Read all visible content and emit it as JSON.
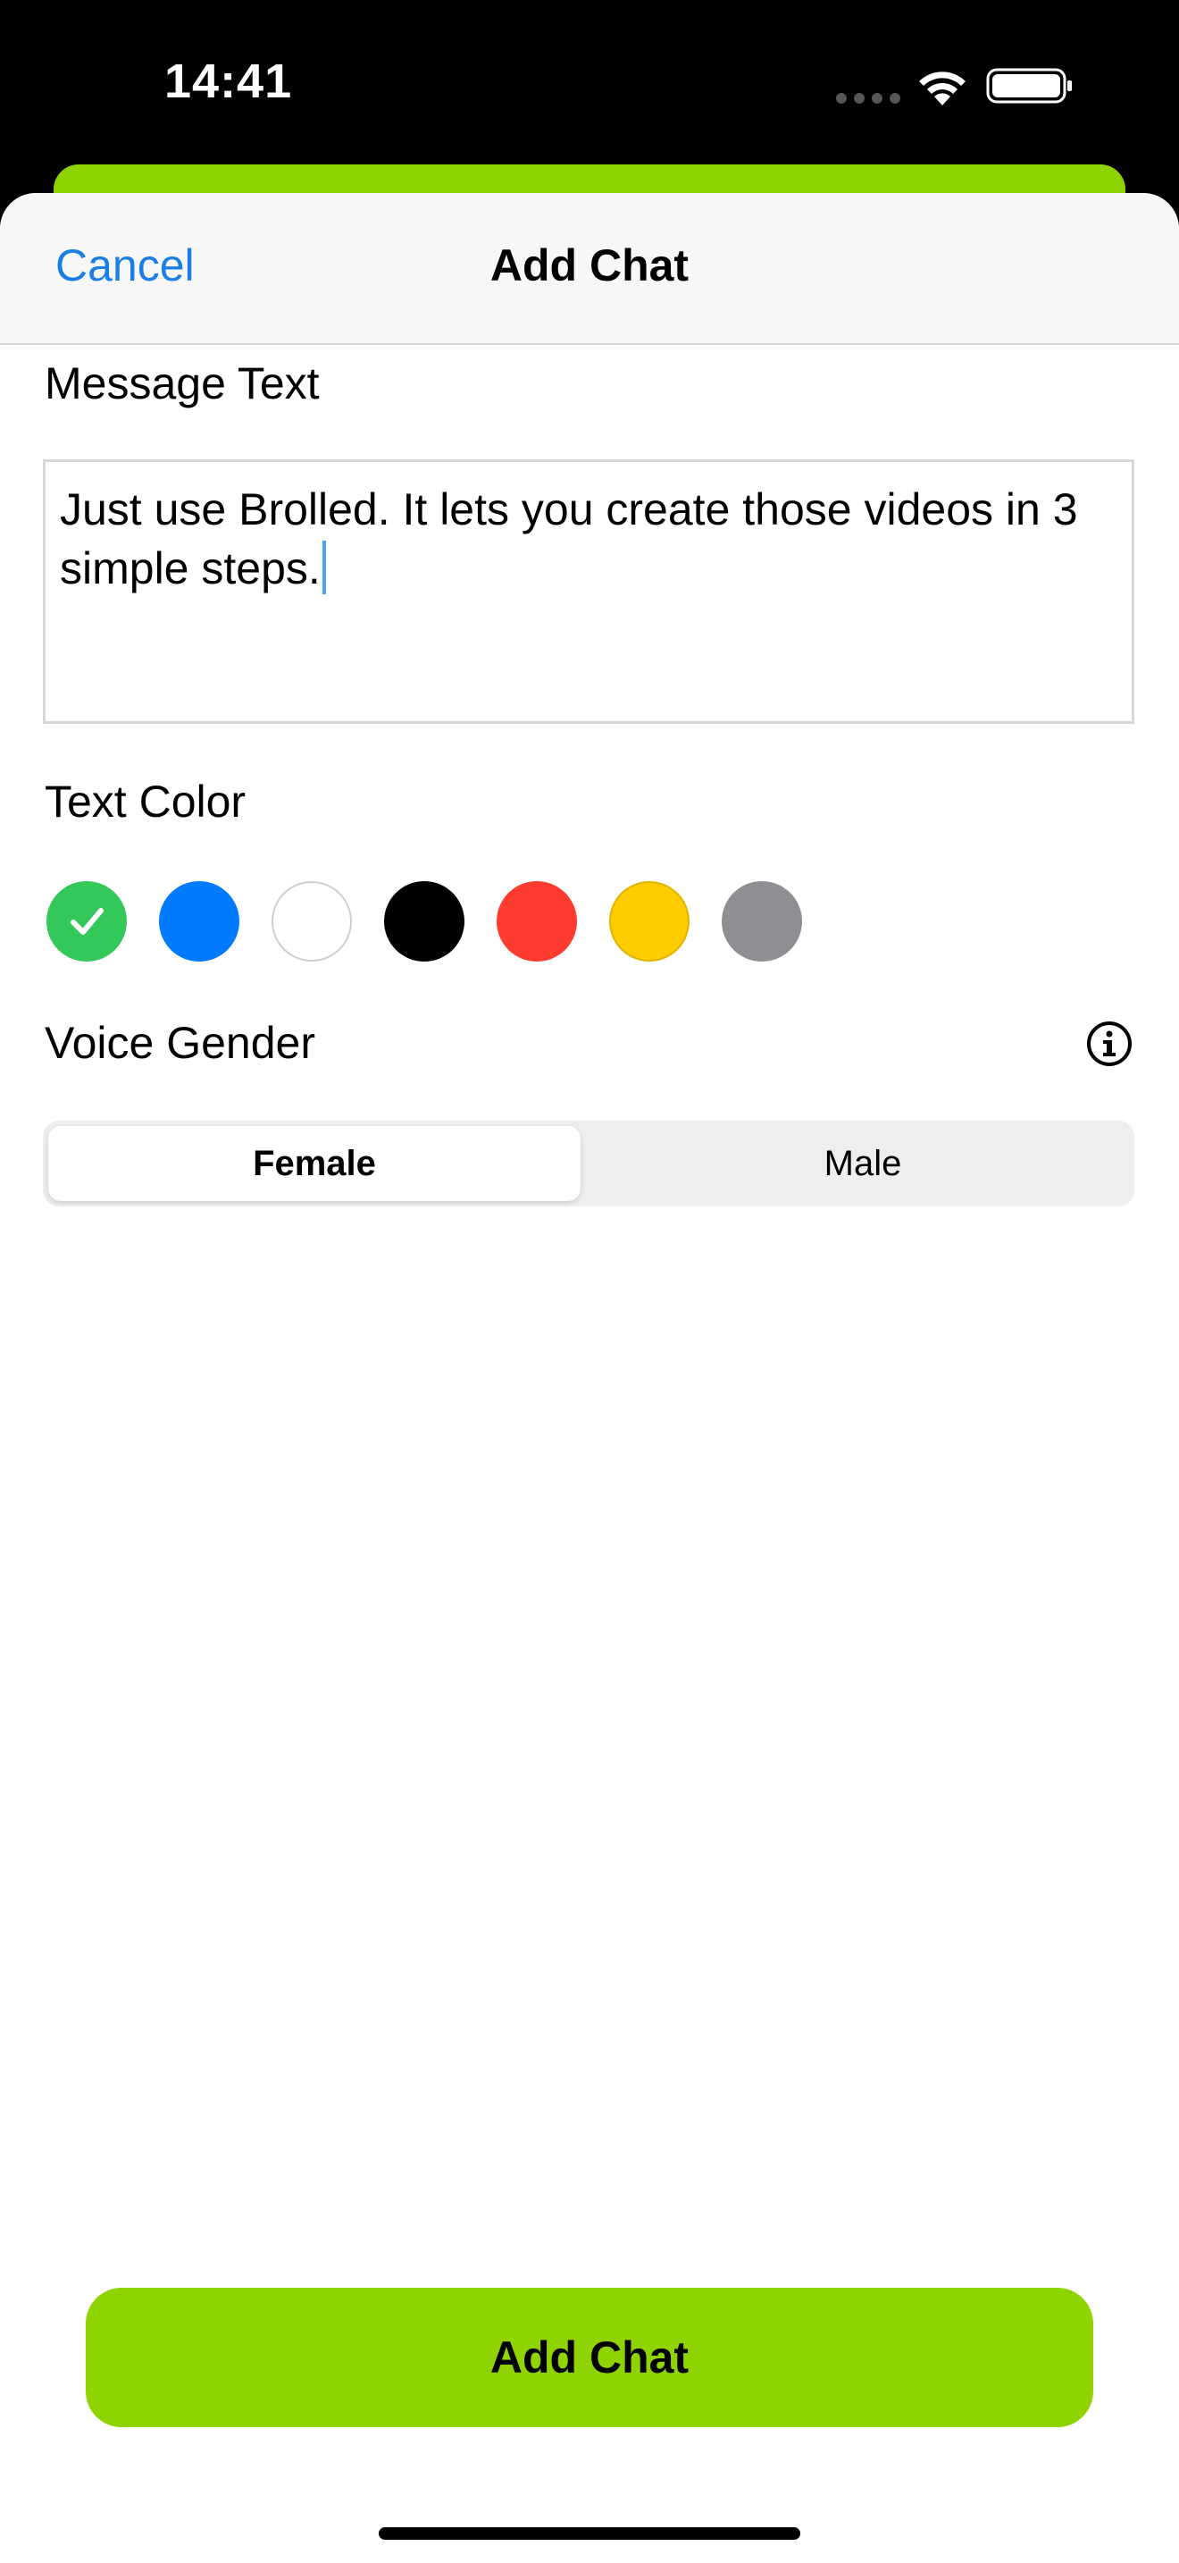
{
  "status_bar": {
    "time": "14:41",
    "icons": [
      "cellular-dots-icon",
      "wifi-icon",
      "battery-icon"
    ]
  },
  "nav": {
    "cancel_label": "Cancel",
    "title": "Add Chat"
  },
  "message": {
    "label": "Message Text",
    "value": "Just use Brolled. It lets you create those videos in 3 simple steps."
  },
  "text_color": {
    "label": "Text Color",
    "selected": "green",
    "options": [
      {
        "name": "green",
        "hex": "#34c759",
        "selected": true
      },
      {
        "name": "blue",
        "hex": "#007aff",
        "selected": false
      },
      {
        "name": "white",
        "hex": "#ffffff",
        "selected": false
      },
      {
        "name": "black",
        "hex": "#000000",
        "selected": false
      },
      {
        "name": "red",
        "hex": "#ff3b30",
        "selected": false
      },
      {
        "name": "yellow",
        "hex": "#ffcc00",
        "selected": false
      },
      {
        "name": "gray",
        "hex": "#8e8e93",
        "selected": false
      }
    ]
  },
  "voice_gender": {
    "label": "Voice Gender",
    "info_icon": "info-circle-icon",
    "options": [
      "Female",
      "Male"
    ],
    "selected": "Female"
  },
  "primary_action": {
    "label": "Add Chat",
    "color": "#8fd400"
  }
}
